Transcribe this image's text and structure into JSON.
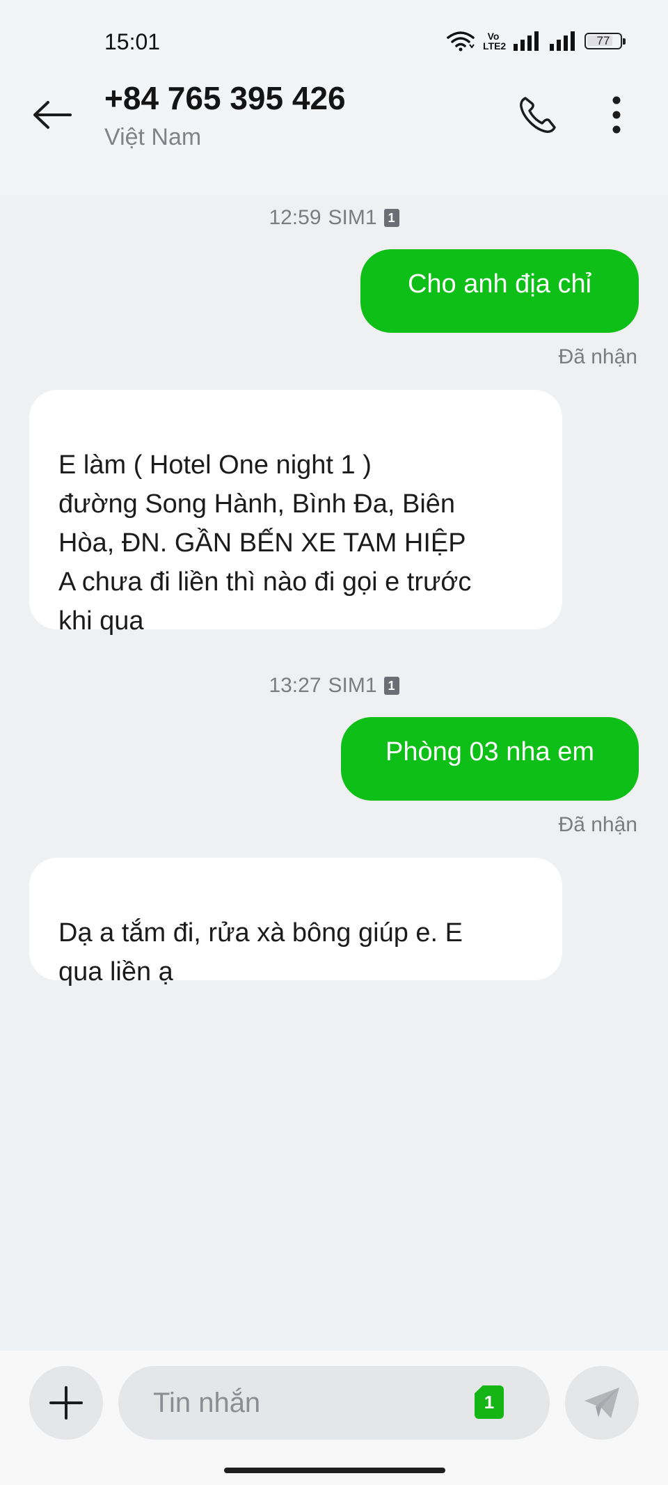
{
  "status_bar": {
    "time": "15:01",
    "volte_label": "Vo LTE2",
    "battery_level": "77"
  },
  "header": {
    "contact_number": "+84 765 395 426",
    "contact_subtitle": "Việt Nam"
  },
  "conversation": [
    {
      "type": "meta",
      "time": "12:59",
      "sim": "SIM1",
      "sim_badge": "1"
    },
    {
      "type": "outgoing",
      "text": "Cho anh địa chỉ",
      "status": "Đã nhận"
    },
    {
      "type": "incoming",
      "text": "E làm ( Hotel One night 1 )\nđường Song Hành, Bình Đa, Biên\nHòa, ĐN. GẦN BẾN XE TAM HIỆP\nA chưa đi liền thì nào đi gọi e trước\nkhi qua"
    },
    {
      "type": "meta",
      "time": "13:27",
      "sim": "SIM1",
      "sim_badge": "1"
    },
    {
      "type": "outgoing",
      "text": "Phòng 03 nha em",
      "status": "Đã nhận"
    },
    {
      "type": "incoming",
      "text": "Dạ a tắm đi, rửa xà bông giúp e. E\nqua liền ạ"
    }
  ],
  "compose": {
    "placeholder": "Tin nhắn",
    "sim_badge": "1"
  },
  "colors": {
    "outgoing_bubble": "#0dbf16",
    "incoming_bubble": "#ffffff",
    "background": "#eff0f2",
    "sim_select": "#14b514"
  },
  "icons": [
    "back-arrow-icon",
    "phone-icon",
    "more-vertical-icon",
    "wifi-icon",
    "signal-icon",
    "battery-icon",
    "plus-icon",
    "send-icon",
    "sim-card-icon"
  ]
}
